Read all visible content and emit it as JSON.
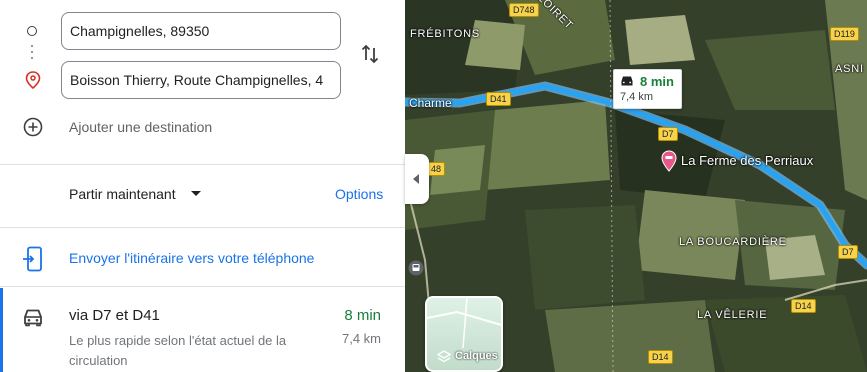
{
  "directions": {
    "origin_value": "Champignelles, 89350",
    "destination_value": "Boisson Thierry, Route Champignelles, 4",
    "add_destination_label": "Ajouter une destination",
    "depart_label": "Partir maintenant",
    "options_label": "Options",
    "send_to_phone_label": "Envoyer l'itinéraire vers votre téléphone"
  },
  "route": {
    "via": "via D7 et D41",
    "duration": "8 min",
    "description": "Le plus rapide selon l'état actuel de la circulation",
    "distance": "7,4 km"
  },
  "map": {
    "places": {
      "frebitons": "FRÉBITONS",
      "charme": "Charme",
      "loiret": "LOIRET",
      "asni": "ASNI",
      "boucardiere": "LA BOUCARDIÈRE",
      "velerie": "LA VÊLERIE"
    },
    "roads": {
      "d748": "D748",
      "d41": "D41",
      "d7_a": "D7",
      "d7_b": "D7",
      "d119": "D119",
      "d14_a": "D14",
      "d14_b": "D14",
      "n48": "48"
    },
    "callout": {
      "duration": "8 min",
      "distance": "7,4 km"
    },
    "poi": "La Ferme des Perriaux",
    "layers_label": "Calques"
  },
  "colors": {
    "accent_blue": "#1a73e8",
    "route_green": "#188038",
    "route_line": "#27a3f3"
  },
  "icons": [
    "origin-circle-icon",
    "destination-pin-icon",
    "swap-icon",
    "add-destination-icon",
    "caret-down-icon",
    "send-to-phone-icon",
    "car-icon",
    "collapse-panel-icon",
    "layers-icon",
    "transit-icon",
    "poi-pin-icon"
  ]
}
